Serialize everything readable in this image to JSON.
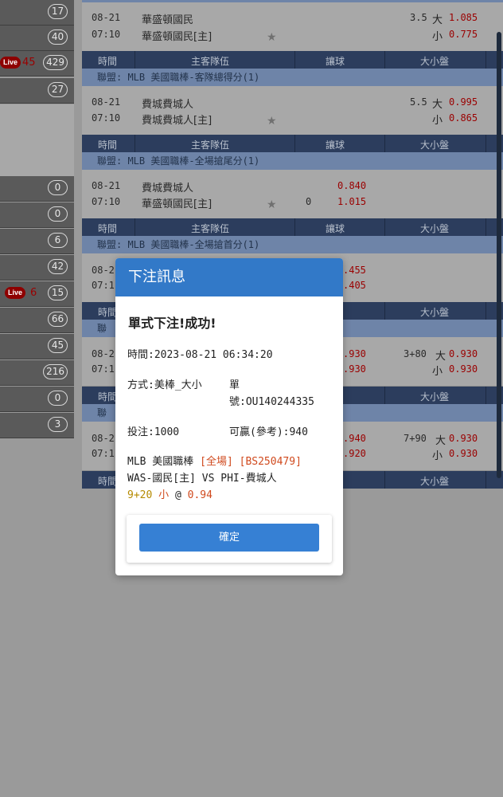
{
  "sidebar": {
    "rows": [
      {
        "count": "17"
      },
      {
        "count": "40"
      },
      {
        "count": "429",
        "live": "Live",
        "live_num": "45"
      },
      {
        "count": "27"
      },
      {
        "count": "0"
      },
      {
        "count": "0"
      },
      {
        "count": "6"
      },
      {
        "count": "42"
      },
      {
        "count": "15",
        "live": "Live",
        "live_num": "6"
      },
      {
        "count": "66"
      },
      {
        "count": "45"
      },
      {
        "count": "216"
      },
      {
        "count": "0"
      },
      {
        "count": "3"
      }
    ]
  },
  "table": {
    "headers": {
      "time": "時間",
      "teams": "主客隊伍",
      "handicap": "讓球",
      "overunder": "大小盤"
    },
    "leagues": {
      "l1": "聯盟: MLB 美國職棒-客隊總得分(1)",
      "l2": "聯盟: MLB 美國職棒-全場搶尾分(1)",
      "l3": "聯盟: MLB 美國職棒-全場搶首分(1)",
      "l4": "聯",
      "l5": "聯"
    },
    "matches": {
      "m1": {
        "date": "08-21",
        "time": "07:10",
        "team1": "華盛頓國民",
        "team2": "華盛頓國民[主]",
        "ou_line": "3.5",
        "ou_big": "大",
        "ou_big_odds": "1.085",
        "ou_small": "小",
        "ou_small_odds": "0.775"
      },
      "m2": {
        "date": "08-21",
        "time": "07:10",
        "team1": "費城費城人",
        "team2": "費城費城人[主]",
        "ou_line": "5.5",
        "ou_big": "大",
        "ou_big_odds": "0.995",
        "ou_small": "小",
        "ou_small_odds": "0.865"
      },
      "m3": {
        "date": "08-21",
        "time": "07:10",
        "team1": "費城費城人",
        "team2": "華盛頓國民[主]",
        "hc_odds1": "0.840",
        "hc_line": "0",
        "hc_odds2": "1.015"
      },
      "m4": {
        "date": "08-2",
        "time": "07:1",
        "hc_odds1": ".455",
        "hc_odds2": ".405"
      },
      "m5": {
        "date": "08-2",
        "time": "07:1",
        "hc_odds1": ".930",
        "hc_odds2": ".930",
        "ou_line": "3+80",
        "ou_big": "大",
        "ou_big_odds": "0.930",
        "ou_small": "小",
        "ou_small_odds": "0.930"
      },
      "m6": {
        "date": "08-2",
        "time": "07:1",
        "hc_odds1": ".940",
        "hc_odds2": ".920",
        "ou_line": "7+90",
        "ou_big": "大",
        "ou_big_odds": "0.930",
        "ou_small": "小",
        "ou_small_odds": "0.930"
      }
    }
  },
  "modal": {
    "title": "下注訊息",
    "heading": "單式下注!成功!",
    "time": "時間:2023-08-21 06:34:20",
    "method": "方式:美棒_大小",
    "order_label1": "單",
    "order_label2": "號:OU140244335",
    "stake": "投注:1000",
    "win": "可贏(參考):940",
    "league_name": "MLB 美國職棒",
    "period": "[全場]",
    "game_code": "[BS250479]",
    "matchup": "WAS-國民[主] VS PHI-費城人",
    "line": "9+20",
    "pick": "小",
    "at": "@",
    "odds": "0.94",
    "confirm": "確定"
  }
}
